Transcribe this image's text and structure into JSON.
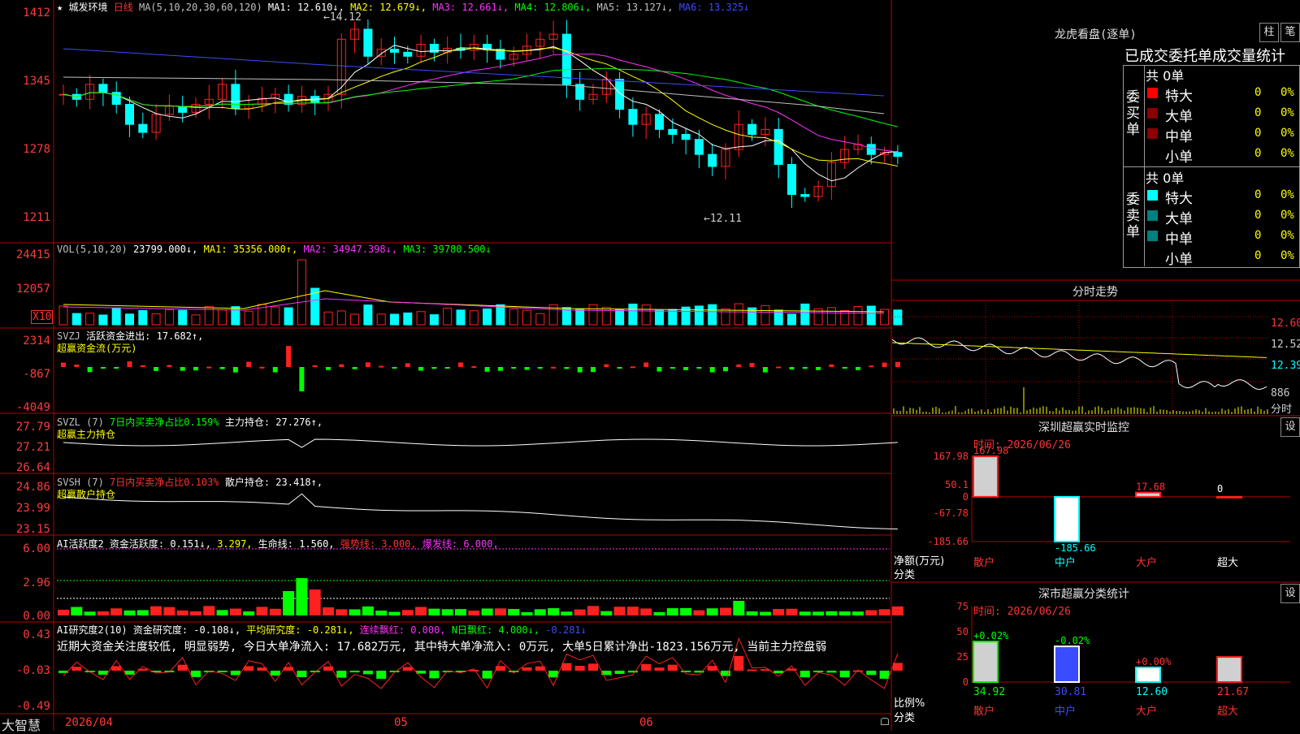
{
  "main": {
    "star": "★",
    "stock_name": "城发环境",
    "period": "日线",
    "ma_label": "MA(5,10,20,30,60,120)",
    "ma1": "MA1: 12.610↓,",
    "ma2": "MA2: 12.679↓,",
    "ma3": "MA3: 12.661↓,",
    "ma4": "MA4: 12.806↓,",
    "ma5": "MA5: 13.127↓,",
    "ma6": "MA6: 13.325↓",
    "y_ticks": [
      "1412",
      "1345",
      "1278",
      "1211"
    ],
    "high_mark": "14.12",
    "low_mark": "12.11"
  },
  "vol": {
    "label": "VOL(5,10,20)",
    "value": "23799.000↓,",
    "ma1": "MA1: 35356.000↑,",
    "ma2": "MA2: 34947.398↓,",
    "ma3": "MA3: 39780.500↓",
    "y_ticks": [
      "24415",
      "12057"
    ],
    "unit": "X10"
  },
  "svzj": {
    "label": "SVZJ",
    "text": "活跃资金进出: 17.682↑,",
    "sub": "超赢资金流(万元)",
    "y_ticks": [
      "2314",
      "-867",
      "-4049"
    ]
  },
  "svzl": {
    "label": "SVZL (7)",
    "ratio": "7日内买卖净占比0.159%",
    "hold": "主力持仓: 27.276↑,",
    "sub": "超赢主力持仓",
    "y_ticks": [
      "27.79",
      "27.21",
      "26.64"
    ]
  },
  "svsh": {
    "label": "SVSH (7)",
    "ratio": "7日内买卖净占比0.103%",
    "hold": "散户持仓: 23.418↑,",
    "sub": "超赢散户持仓",
    "y_ticks": [
      "24.86",
      "23.99",
      "23.15"
    ]
  },
  "ai1": {
    "label": "AI活跃度2",
    "a": "资金活跃度: 0.151↓,",
    "b": "3.297,",
    "c": "生命线: 1.560,",
    "d": "强势线: 3.000,",
    "e": "爆发线: 6.000,",
    "y_ticks": [
      "6.00",
      "2.96",
      "0.00"
    ]
  },
  "ai2": {
    "label": "AI研究度2(10)",
    "a": "资金研究度: -0.108↓,",
    "b": "平均研究度: -0.281↓,",
    "c": "连续飘红: 0.000,",
    "d": "N日飘红: 4.000↓,",
    "e": "-0.281↓",
    "comment": "近期大资金关注度较低, 明显弱势, 今日大单净流入: 17.682万元, 其中特大单净流入: 0万元, 大单5日累计净出-1823.156万元, 当前主力控盘弱",
    "y_ticks": [
      "0.43",
      "-0.03",
      "-0.49"
    ]
  },
  "bottom": {
    "brand": "大智慧",
    "dates": [
      "2026/04",
      "05",
      "06"
    ]
  },
  "dragon": {
    "title": "龙虎看盘(逐单)",
    "btn1": "柱",
    "btn2": "笔",
    "header": "已成交委托单成交量统计",
    "buy_total": "共 0单",
    "buy_side": "委买单",
    "sell_total": "共 0单",
    "sell_side": "委卖单",
    "rows": [
      "特大",
      "大单",
      "中单",
      "小单"
    ],
    "zero": "0",
    "pct": "0%"
  },
  "intraday": {
    "title": "分时走势",
    "prices": [
      "12.60",
      "12.52",
      "12.39"
    ],
    "vol": "886",
    "footer": "分时"
  },
  "monitor": {
    "title": "深圳超赢实时监控",
    "btn": "设",
    "time": "时间: 2026/06/26",
    "y_ticks": [
      "167.98",
      "50.1",
      "0",
      "-67.78",
      "-185.66"
    ],
    "values": [
      "167.98",
      "-185.66",
      "17.68",
      "0"
    ],
    "ylabel1": "净额(万元)",
    "ylabel2": "分类",
    "cats": [
      "散户",
      "中户",
      "大户",
      "超大"
    ]
  },
  "classify": {
    "title": "深市超赢分类统计",
    "btn": "设",
    "time": "时间: 2026/06/26",
    "y_ticks": [
      "75",
      "50",
      "25",
      "0"
    ],
    "deltas": [
      "+0.02%",
      "-0.02%",
      "+0.00%"
    ],
    "values": [
      "34.92",
      "30.81",
      "12.60",
      "21.67"
    ],
    "ylabel1": "比例%",
    "ylabel2": "分类",
    "cats": [
      "散户",
      "中户",
      "大户",
      "超大"
    ]
  },
  "chart_data": {
    "type": "bar",
    "title": "深圳超赢实时监控",
    "categories": [
      "散户",
      "中户",
      "大户",
      "超大"
    ],
    "values": [
      167.98,
      -185.66,
      17.68,
      0
    ],
    "ylabel": "净额(万元)",
    "ylim": [
      -185.66,
      167.98
    ]
  },
  "colors": {
    "up": "#ff2020",
    "down": "#00ffff",
    "frame": "#b40000"
  }
}
